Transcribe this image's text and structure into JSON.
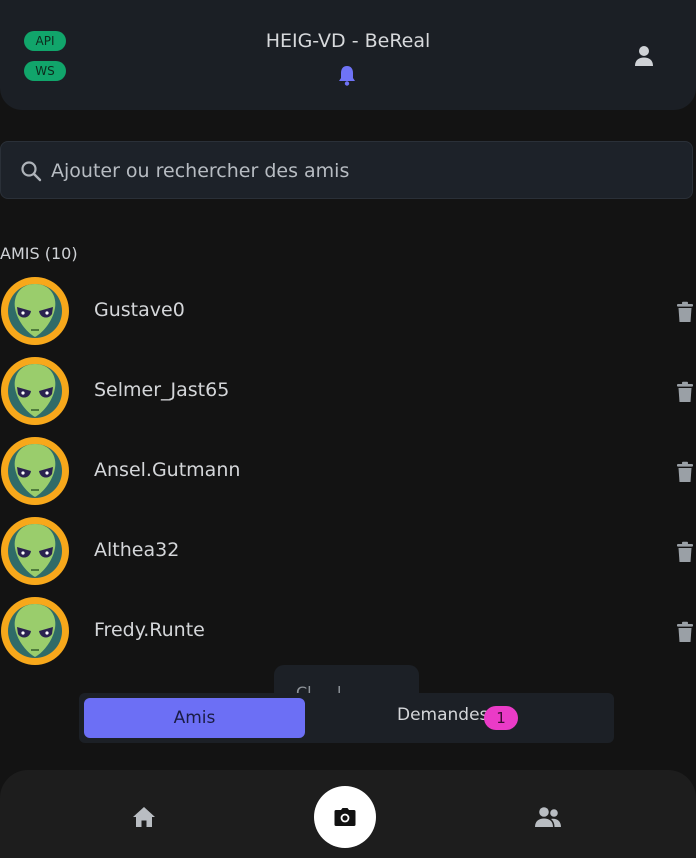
{
  "header": {
    "badges": [
      "API",
      "WS"
    ],
    "title": "HEIG-VD - BeReal",
    "bell_icon": "bell-icon",
    "user_icon": "user-icon"
  },
  "search": {
    "placeholder": "Ajouter ou rechercher des amis",
    "icon": "search-icon"
  },
  "friends_section": {
    "title": "AMIS (10)",
    "friends": [
      {
        "name": "Gustave0"
      },
      {
        "name": "Selmer_Jast65"
      },
      {
        "name": "Ansel.Gutmann"
      },
      {
        "name": "Althea32"
      },
      {
        "name": "Fredy.Runte"
      }
    ]
  },
  "ghost_popup": {
    "text": "Cl    ....l"
  },
  "tabs": {
    "amis": "Amis",
    "demandes": "Demandes",
    "demandes_count": "1"
  },
  "bottom_nav": {
    "home_icon": "home-icon",
    "camera_icon": "camera-icon",
    "friends_icon": "users-icon"
  },
  "colors": {
    "background": "#131313",
    "header": "#1b1f25",
    "status_pill": "#11a56b",
    "accent": "#6c6ff5",
    "badge": "#ea3bc7",
    "avatar_ring": "#f7a81b"
  }
}
